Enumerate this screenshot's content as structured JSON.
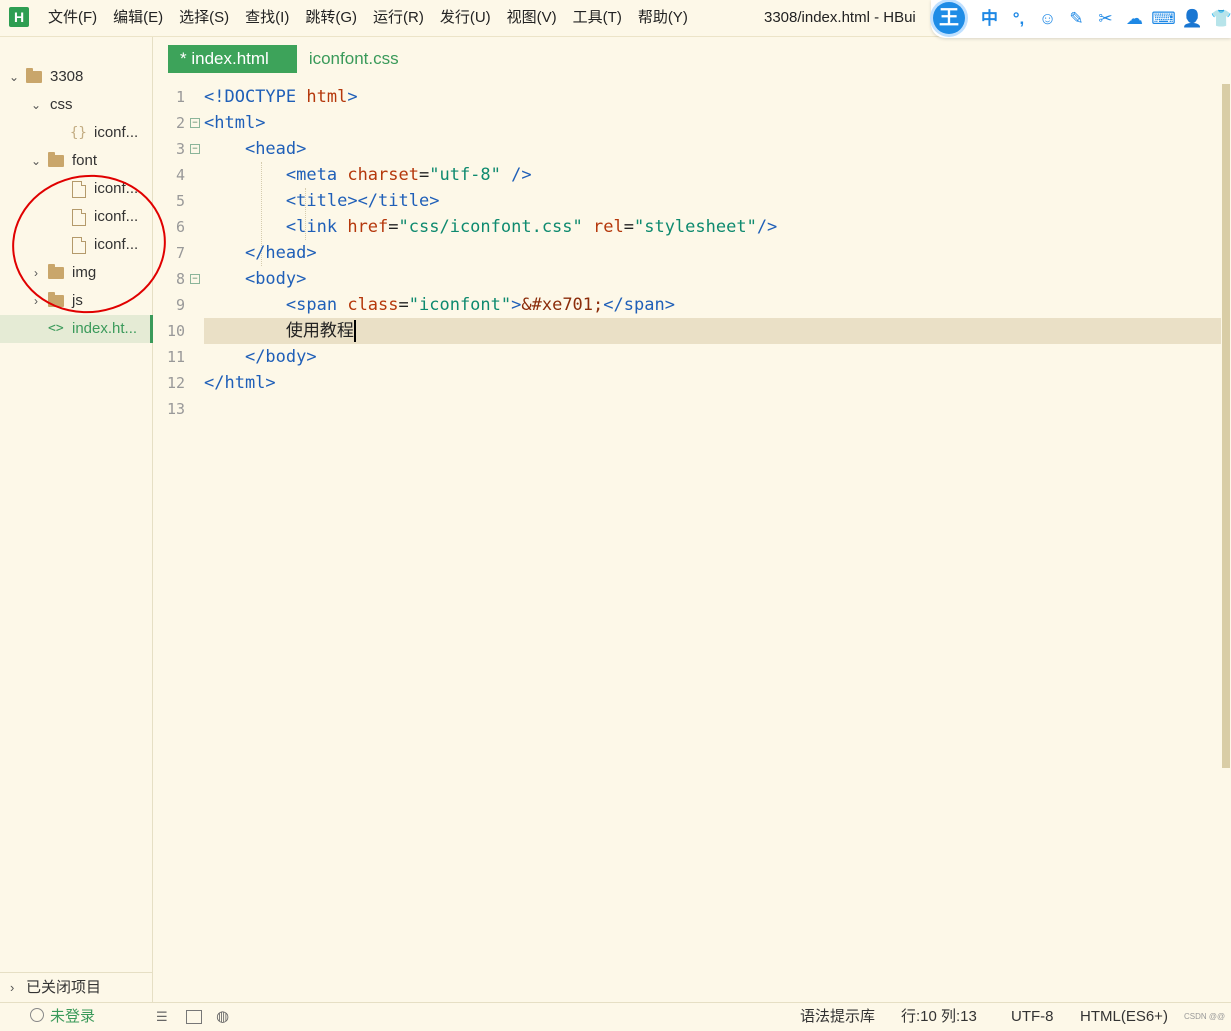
{
  "app": {
    "logo": "H",
    "window_title": "3308/index.html - HBui"
  },
  "menu": [
    "文件(F)",
    "编辑(E)",
    "选择(S)",
    "查找(I)",
    "跳转(G)",
    "运行(R)",
    "发行(U)",
    "视图(V)",
    "工具(T)",
    "帮助(Y)"
  ],
  "ime": {
    "logo": "王",
    "icons": [
      "中",
      "°,",
      "☺",
      "✎",
      "✂",
      "☁",
      "⌨",
      "👤",
      "👕"
    ]
  },
  "sidebar": {
    "tree": [
      {
        "label": "3308",
        "chev": "⌄",
        "icon": "folder",
        "depth": 0
      },
      {
        "label": "css",
        "chev": "⌄",
        "icon": "none",
        "depth": 1
      },
      {
        "label": "iconf...",
        "chev": "",
        "icon": "css",
        "depth": 2
      },
      {
        "label": "font",
        "chev": "⌄",
        "icon": "folder",
        "depth": 1
      },
      {
        "label": "iconf...",
        "chev": "",
        "icon": "file",
        "depth": 2
      },
      {
        "label": "iconf...",
        "chev": "",
        "icon": "file",
        "depth": 2
      },
      {
        "label": "iconf...",
        "chev": "",
        "icon": "file",
        "depth": 2
      },
      {
        "label": "img",
        "chev": "›",
        "icon": "folder",
        "depth": 1
      },
      {
        "label": "js",
        "chev": "›",
        "icon": "folder",
        "depth": 1
      },
      {
        "label": "index.ht...",
        "chev": "",
        "icon": "html",
        "depth": 1,
        "selected": true
      }
    ],
    "closed_projects": "已关闭项目"
  },
  "tabs": [
    {
      "label": "* index.html",
      "active": true
    },
    {
      "label": "iconfont.css",
      "active": false
    }
  ],
  "editor": {
    "current_line": 10,
    "lines": [
      {
        "n": "1",
        "fold": "",
        "text": "<!DOCTYPE html>"
      },
      {
        "n": "2",
        "fold": "⊟",
        "text": "<html>"
      },
      {
        "n": "3",
        "fold": "⊟",
        "text": "    <head>"
      },
      {
        "n": "4",
        "fold": "",
        "text": "        <meta charset=\"utf-8\" />"
      },
      {
        "n": "5",
        "fold": "",
        "text": "        <title></title>"
      },
      {
        "n": "6",
        "fold": "",
        "text": "        <link href=\"css/iconfont.css\" rel=\"stylesheet\"/>"
      },
      {
        "n": "7",
        "fold": "",
        "text": "    </head>"
      },
      {
        "n": "8",
        "fold": "⊟",
        "text": "    <body>"
      },
      {
        "n": "9",
        "fold": "",
        "text": "        <span class=\"iconfont\">&#xe701;</span>"
      },
      {
        "n": "10",
        "fold": "",
        "text": "        使用教程"
      },
      {
        "n": "11",
        "fold": "",
        "text": "    </body>"
      },
      {
        "n": "12",
        "fold": "",
        "text": "</html>"
      },
      {
        "n": "13",
        "fold": "",
        "text": ""
      }
    ]
  },
  "status": {
    "login": "未登录",
    "syntax_lib": "语法提示库",
    "position": "行:10  列:13",
    "encoding": "UTF-8",
    "language": "HTML(ES6+)",
    "watermark": "CSDN @@"
  }
}
